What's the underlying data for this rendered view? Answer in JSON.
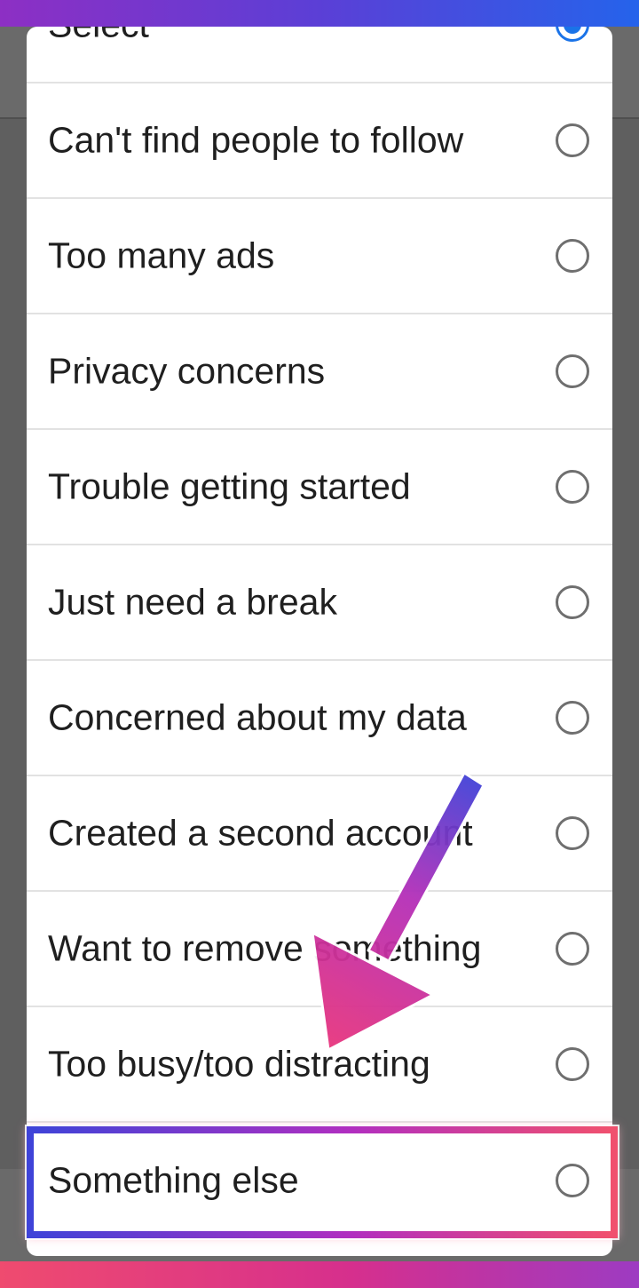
{
  "dialog": {
    "options": [
      {
        "label": "Select",
        "selected": true
      },
      {
        "label": "Can't find people to follow",
        "selected": false
      },
      {
        "label": "Too many ads",
        "selected": false
      },
      {
        "label": "Privacy concerns",
        "selected": false
      },
      {
        "label": "Trouble getting started",
        "selected": false
      },
      {
        "label": "Just need a break",
        "selected": false
      },
      {
        "label": "Concerned about my data",
        "selected": false
      },
      {
        "label": "Created a second account",
        "selected": false
      },
      {
        "label": "Want to remove something",
        "selected": false
      },
      {
        "label": "Too busy/too distracting",
        "selected": false
      },
      {
        "label": "Something else",
        "selected": false
      }
    ]
  },
  "annotation": {
    "highlight_target": "Something else",
    "arrow_colors": [
      "#3f43d8",
      "#e8357d"
    ]
  },
  "colors": {
    "radio_border": "#6f6f6f",
    "radio_selected": "#1a73e8",
    "text": "#1f1f1f"
  }
}
